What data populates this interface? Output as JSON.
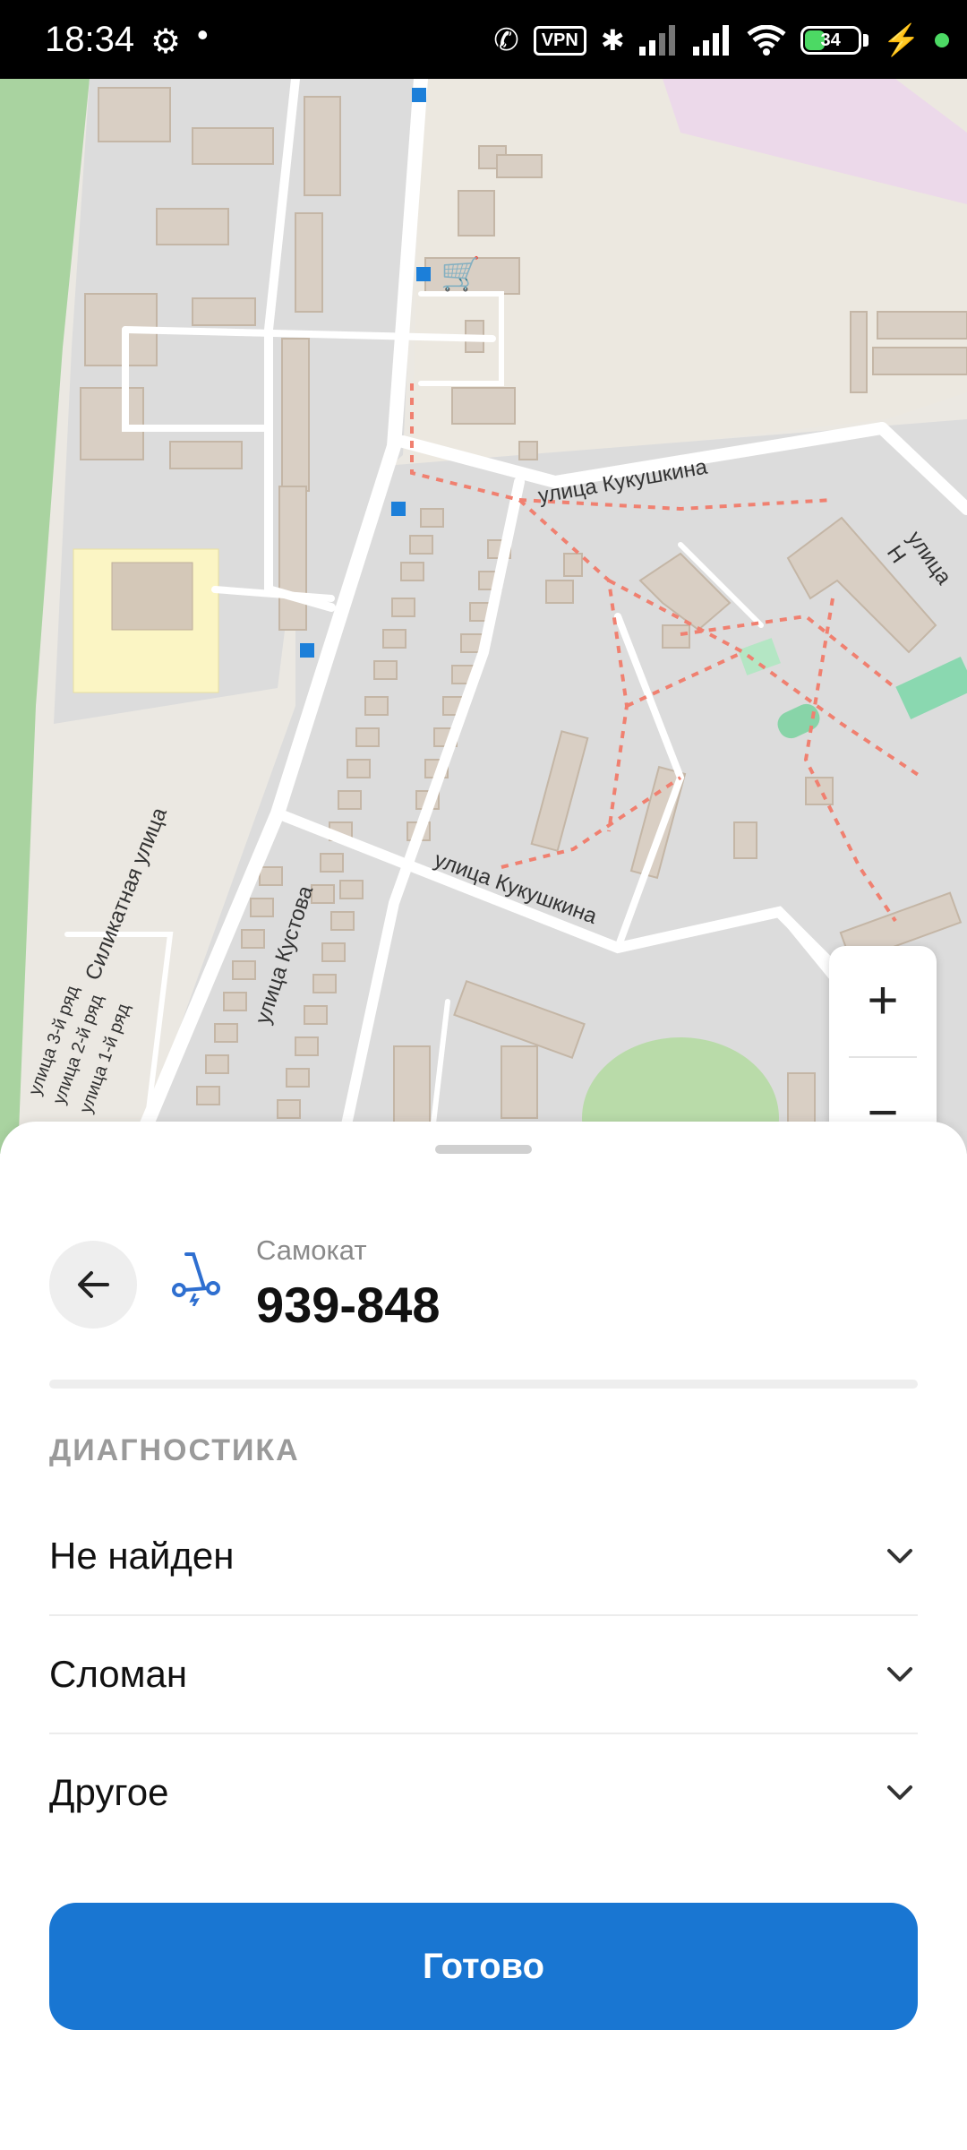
{
  "status_bar": {
    "time": "18:34",
    "vpn_label": "VPN",
    "battery_level": "34"
  },
  "map": {
    "street_labels": [
      "улица Кукушкина",
      "улица Кукушкина",
      "Силикатная улица",
      "улица Кустова",
      "улица 3-й ряд",
      "улица 2-й ряд",
      "улица 1-й ряд",
      "улица Н"
    ],
    "zoom_in": "+",
    "zoom_out": "−"
  },
  "sheet": {
    "vehicle_type": "Самокат",
    "vehicle_number": "939-848",
    "section_title": "ДИАГНОСТИКА",
    "items": [
      {
        "label": "Не найден"
      },
      {
        "label": "Сломан"
      },
      {
        "label": "Другое"
      }
    ],
    "done_label": "Готово"
  },
  "colors": {
    "accent": "#1976d2",
    "scooter_icon": "#2f6fd0"
  }
}
